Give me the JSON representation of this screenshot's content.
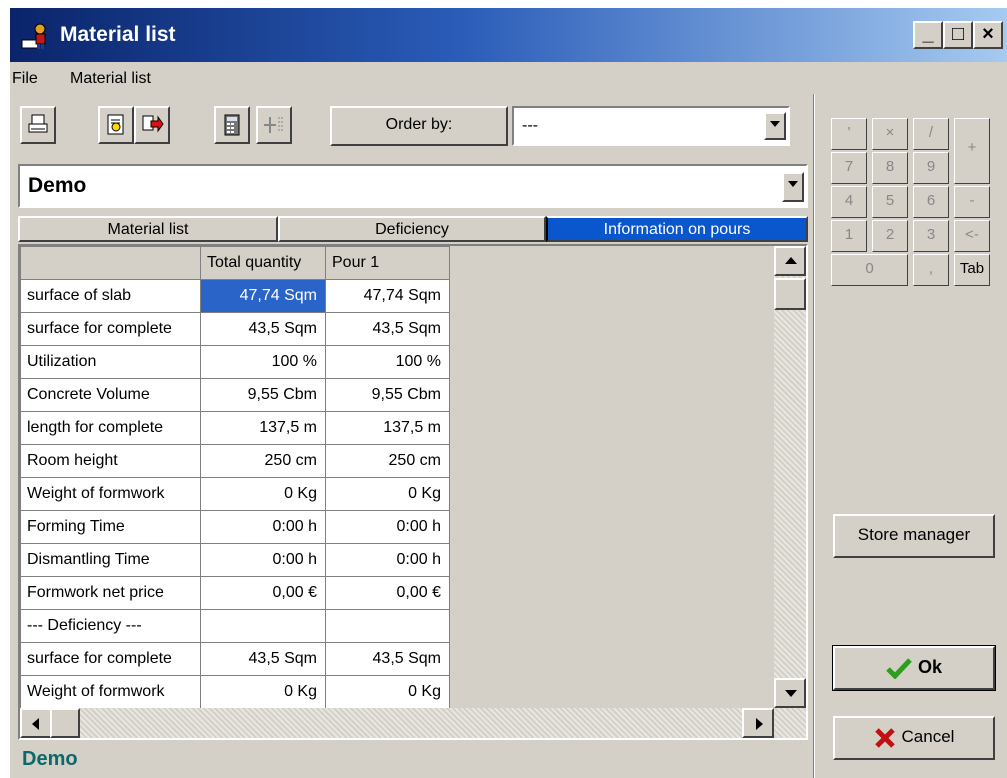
{
  "window": {
    "title": "Material list"
  },
  "menu": [
    "File",
    "Material list"
  ],
  "toolbar": {
    "print_icon": "printer-icon",
    "preview_icon": "page-preview-icon",
    "export_icon": "export-icon",
    "calculator_icon": "calculator-icon",
    "insert_icon": "insert-grid-icon",
    "order_by_label": "Order by:",
    "order_by_value": "---"
  },
  "project": {
    "value": "Demo"
  },
  "tabs": [
    {
      "label": "Material list",
      "active": false
    },
    {
      "label": "Deficiency",
      "active": false
    },
    {
      "label": "Information on pours",
      "active": true
    }
  ],
  "grid": {
    "columns": [
      "",
      "Total quantity",
      "Pour 1"
    ],
    "rows": [
      {
        "label": "surface of slab",
        "total": "47,74 Sqm",
        "pour1": "47,74 Sqm",
        "selected": true
      },
      {
        "label": "surface for complete",
        "total": "43,5 Sqm",
        "pour1": "43,5 Sqm"
      },
      {
        "label": "Utilization",
        "total": "100 %",
        "pour1": "100 %"
      },
      {
        "label": "Concrete Volume",
        "total": "9,55 Cbm",
        "pour1": "9,55 Cbm"
      },
      {
        "label": "length for complete",
        "total": "137,5 m",
        "pour1": "137,5 m"
      },
      {
        "label": "Room height",
        "total": "250 cm",
        "pour1": "250 cm"
      },
      {
        "label": "Weight of formwork",
        "total": "0 Kg",
        "pour1": "0 Kg"
      },
      {
        "label": "Forming Time",
        "total": "0:00 h",
        "pour1": "0:00 h"
      },
      {
        "label": "Dismantling Time",
        "total": "0:00 h",
        "pour1": "0:00 h"
      },
      {
        "label": "Formwork net price",
        "total": "0,00 €",
        "pour1": "0,00 €"
      },
      {
        "label": "--- Deficiency ---",
        "total": "",
        "pour1": ""
      },
      {
        "label": "surface for complete",
        "total": "43,5 Sqm",
        "pour1": "43,5 Sqm"
      },
      {
        "label": "Weight of formwork",
        "total": "0 Kg",
        "pour1": "0 Kg"
      }
    ]
  },
  "status": {
    "text": "Demo"
  },
  "keypad": {
    "keys": [
      "'",
      "×",
      "/",
      "+",
      "7",
      "8",
      "9",
      "4",
      "5",
      "6",
      "-",
      "1",
      "2",
      "3",
      "<-",
      "0",
      ",",
      "Tab"
    ]
  },
  "buttons": {
    "store_manager": "Store manager",
    "ok": "Ok",
    "cancel": "Cancel"
  },
  "colors": {
    "title_start": "#0a246a",
    "title_end": "#a6caf0",
    "active_tab": "#0a56cc",
    "selected_cell": "#2b64c8",
    "status_text": "#0a6a6a",
    "ok_check": "#2e9e1e",
    "cancel_x": "#c01010"
  }
}
